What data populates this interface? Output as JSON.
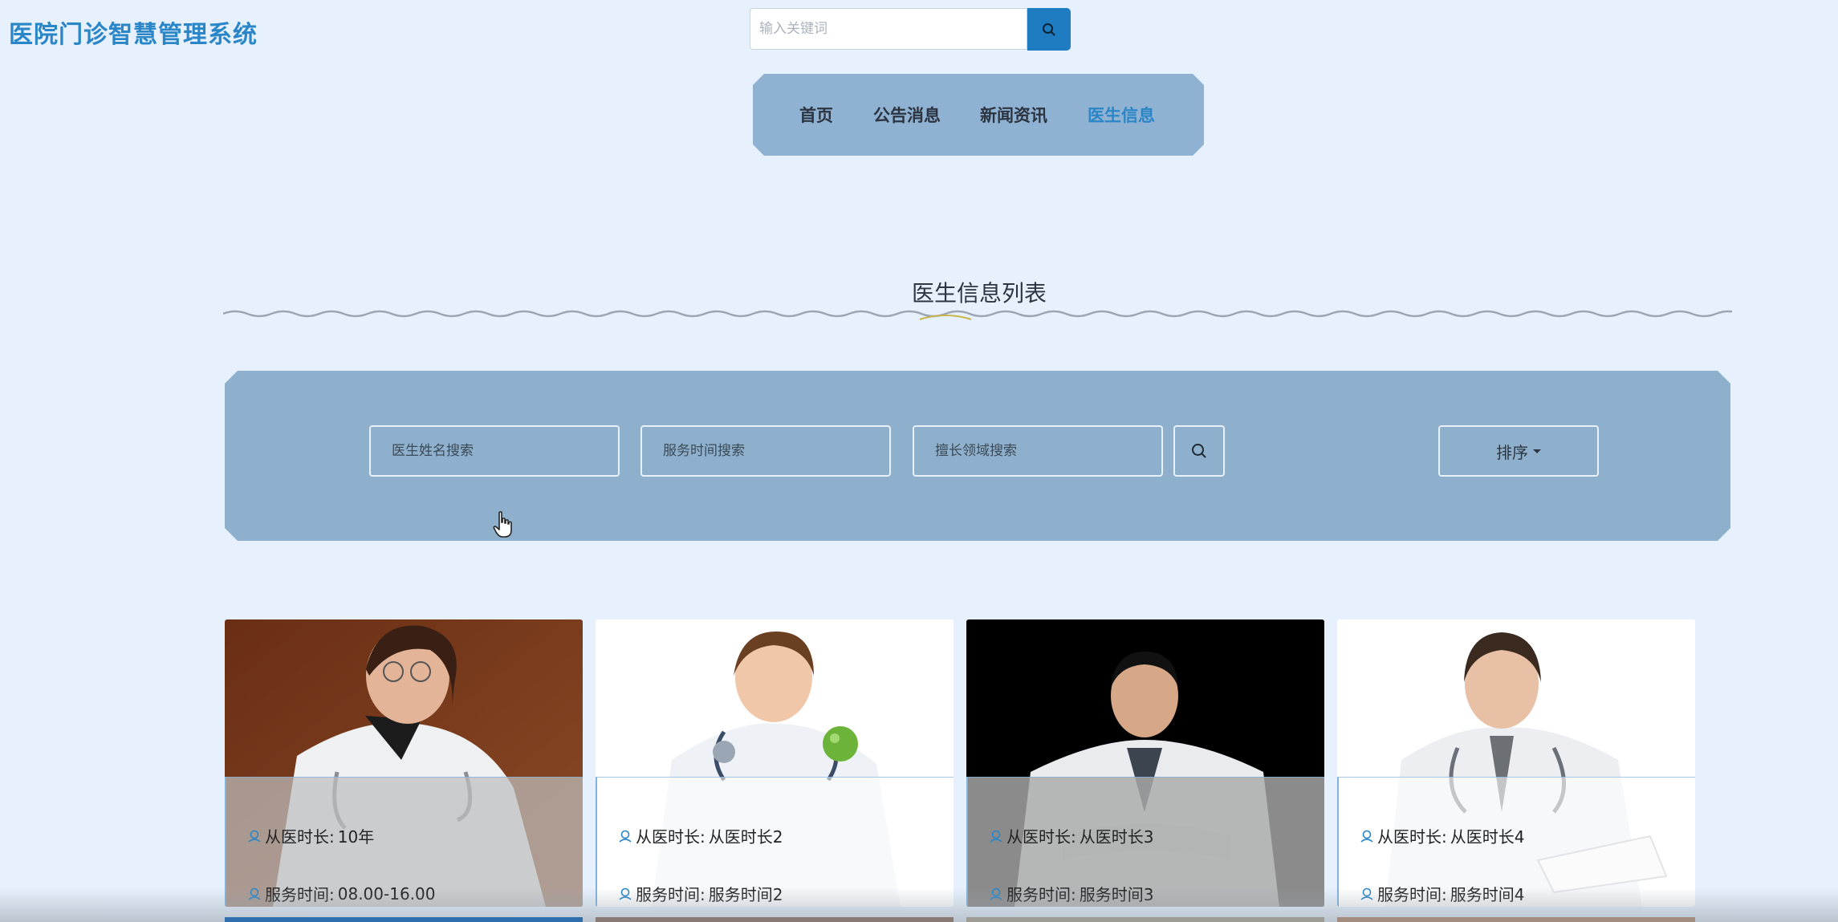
{
  "header": {
    "site_title": "医院门诊智慧管理系统",
    "search_placeholder": "输入关键词",
    "search_button_icon": "search-icon"
  },
  "nav": {
    "items": [
      {
        "label": "首页",
        "active": false
      },
      {
        "label": "公告消息",
        "active": false
      },
      {
        "label": "新闻资讯",
        "active": false
      },
      {
        "label": "医生信息",
        "active": true
      }
    ]
  },
  "section": {
    "title": "医生信息列表"
  },
  "filters": {
    "name_placeholder": "医生姓名搜索",
    "time_placeholder": "服务时间搜索",
    "field_placeholder": "擅长领域搜索",
    "search_icon": "search-icon",
    "sort_label": "排序"
  },
  "cards": [
    {
      "experience_label": "从医时长:",
      "experience": "10年",
      "service_label": "服务时间:",
      "service_time": "08.00-16.00",
      "icon": "user-icon"
    },
    {
      "experience_label": "从医时长:",
      "experience": "从医时长2",
      "service_label": "服务时间:",
      "service_time": "服务时间2",
      "icon": "user-icon"
    },
    {
      "experience_label": "从医时长:",
      "experience": "从医时长3",
      "service_label": "服务时间:",
      "service_time": "服务时间3",
      "icon": "user-icon"
    },
    {
      "experience_label": "从医时长:",
      "experience": "从医时长4",
      "service_label": "服务时间:",
      "service_time": "服务时间4",
      "icon": "user-icon"
    }
  ],
  "colors": {
    "background": "#e7f1fd",
    "accent": "#2a86c7",
    "nav_bg": "#8fb2d2",
    "panel_bg": "#8eb0cc"
  }
}
